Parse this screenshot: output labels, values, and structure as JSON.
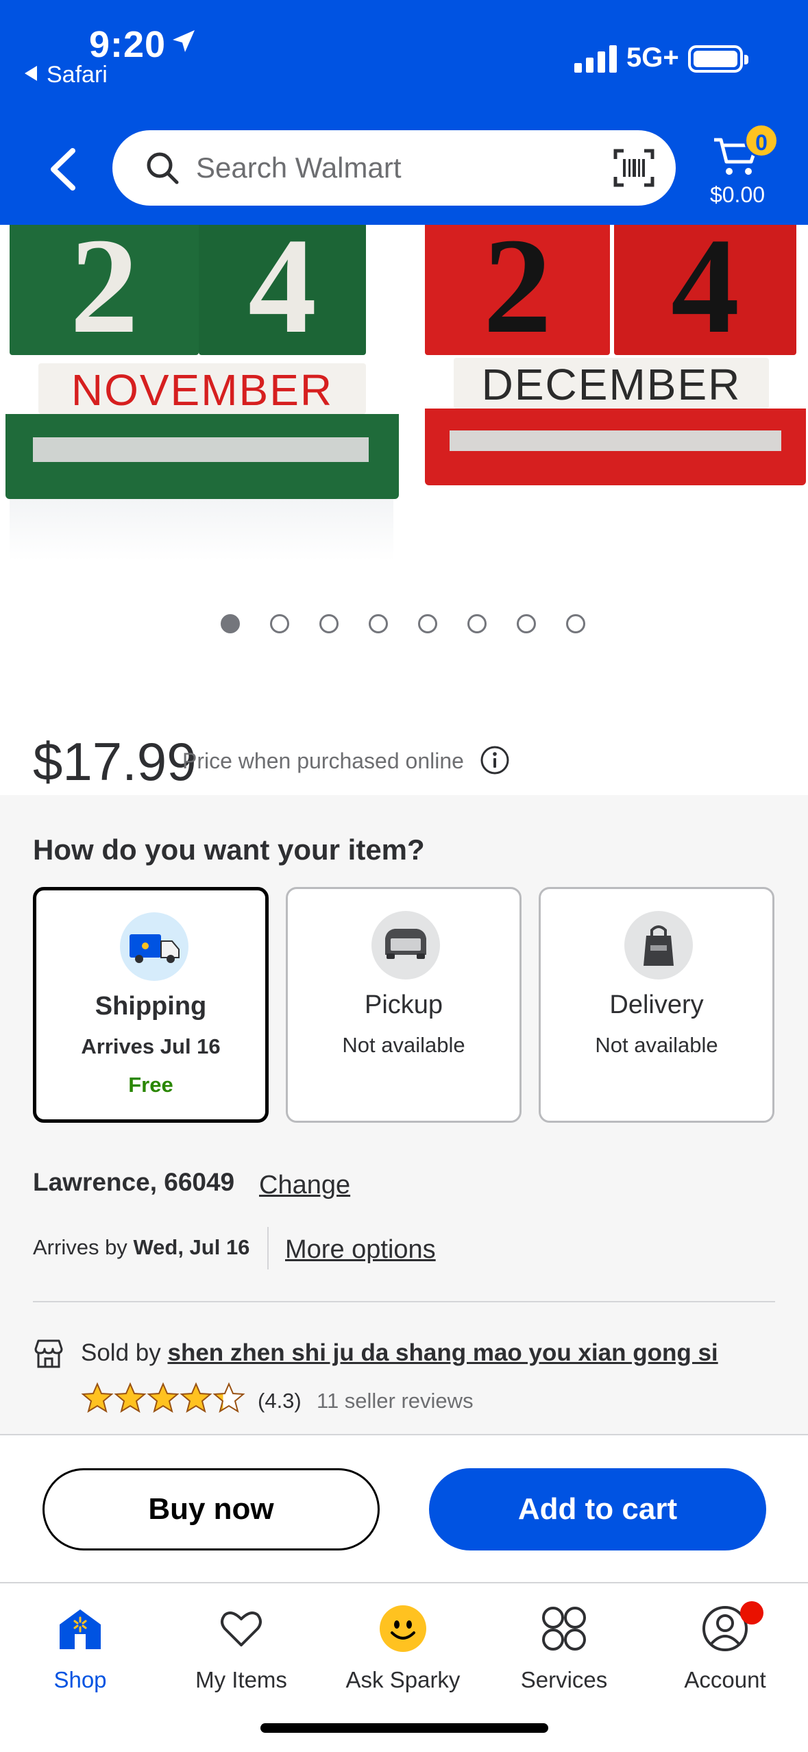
{
  "status_bar": {
    "time": "9:20",
    "back_app": "Safari",
    "network": "5G+"
  },
  "header": {
    "search_placeholder": "Search Walmart",
    "cart_count": "0",
    "cart_total": "$0.00"
  },
  "product_image": {
    "left_set": {
      "digits": [
        "2",
        "4"
      ],
      "month": "NOVEMBER"
    },
    "right_set": {
      "digits": [
        "2",
        "4"
      ],
      "month": "DECEMBER"
    },
    "carousel_count": 8,
    "carousel_active_index": 0
  },
  "price": {
    "amount": "$17.99",
    "note": "Price when purchased online"
  },
  "fulfillment": {
    "title": "How do you want your item?",
    "options": [
      {
        "title": "Shipping",
        "subtitle": "Arrives Jul 16",
        "extra": "Free",
        "selected": true
      },
      {
        "title": "Pickup",
        "subtitle": "Not available",
        "selected": false
      },
      {
        "title": "Delivery",
        "subtitle": "Not available",
        "selected": false
      }
    ],
    "location": "Lawrence, 66049",
    "change_label": "Change",
    "arrives_prefix": "Arrives by",
    "arrives_date": "Wed, Jul 16",
    "more_options_label": "More options"
  },
  "seller": {
    "sold_by_prefix": "Sold by",
    "name": "shen zhen shi ju da shang mao you xian gong si",
    "rating_text": "(4.3)",
    "rating_value": 4.3,
    "reviews": "11 seller reviews"
  },
  "actions": {
    "buy_now": "Buy now",
    "add_to_cart": "Add to cart"
  },
  "tabs": [
    {
      "label": "Shop",
      "icon": "shop-icon",
      "active": true
    },
    {
      "label": "My Items",
      "icon": "heart-icon",
      "active": false
    },
    {
      "label": "Ask Sparky",
      "icon": "sparky-icon",
      "active": false
    },
    {
      "label": "Services",
      "icon": "services-icon",
      "active": false
    },
    {
      "label": "Account",
      "icon": "account-icon",
      "active": false
    }
  ],
  "colors": {
    "brand_blue": "#0053e2",
    "spark_yellow": "#ffc220",
    "free_green": "#2a8703",
    "block_green": "#1f6b3a",
    "block_red": "#d61f1f"
  }
}
